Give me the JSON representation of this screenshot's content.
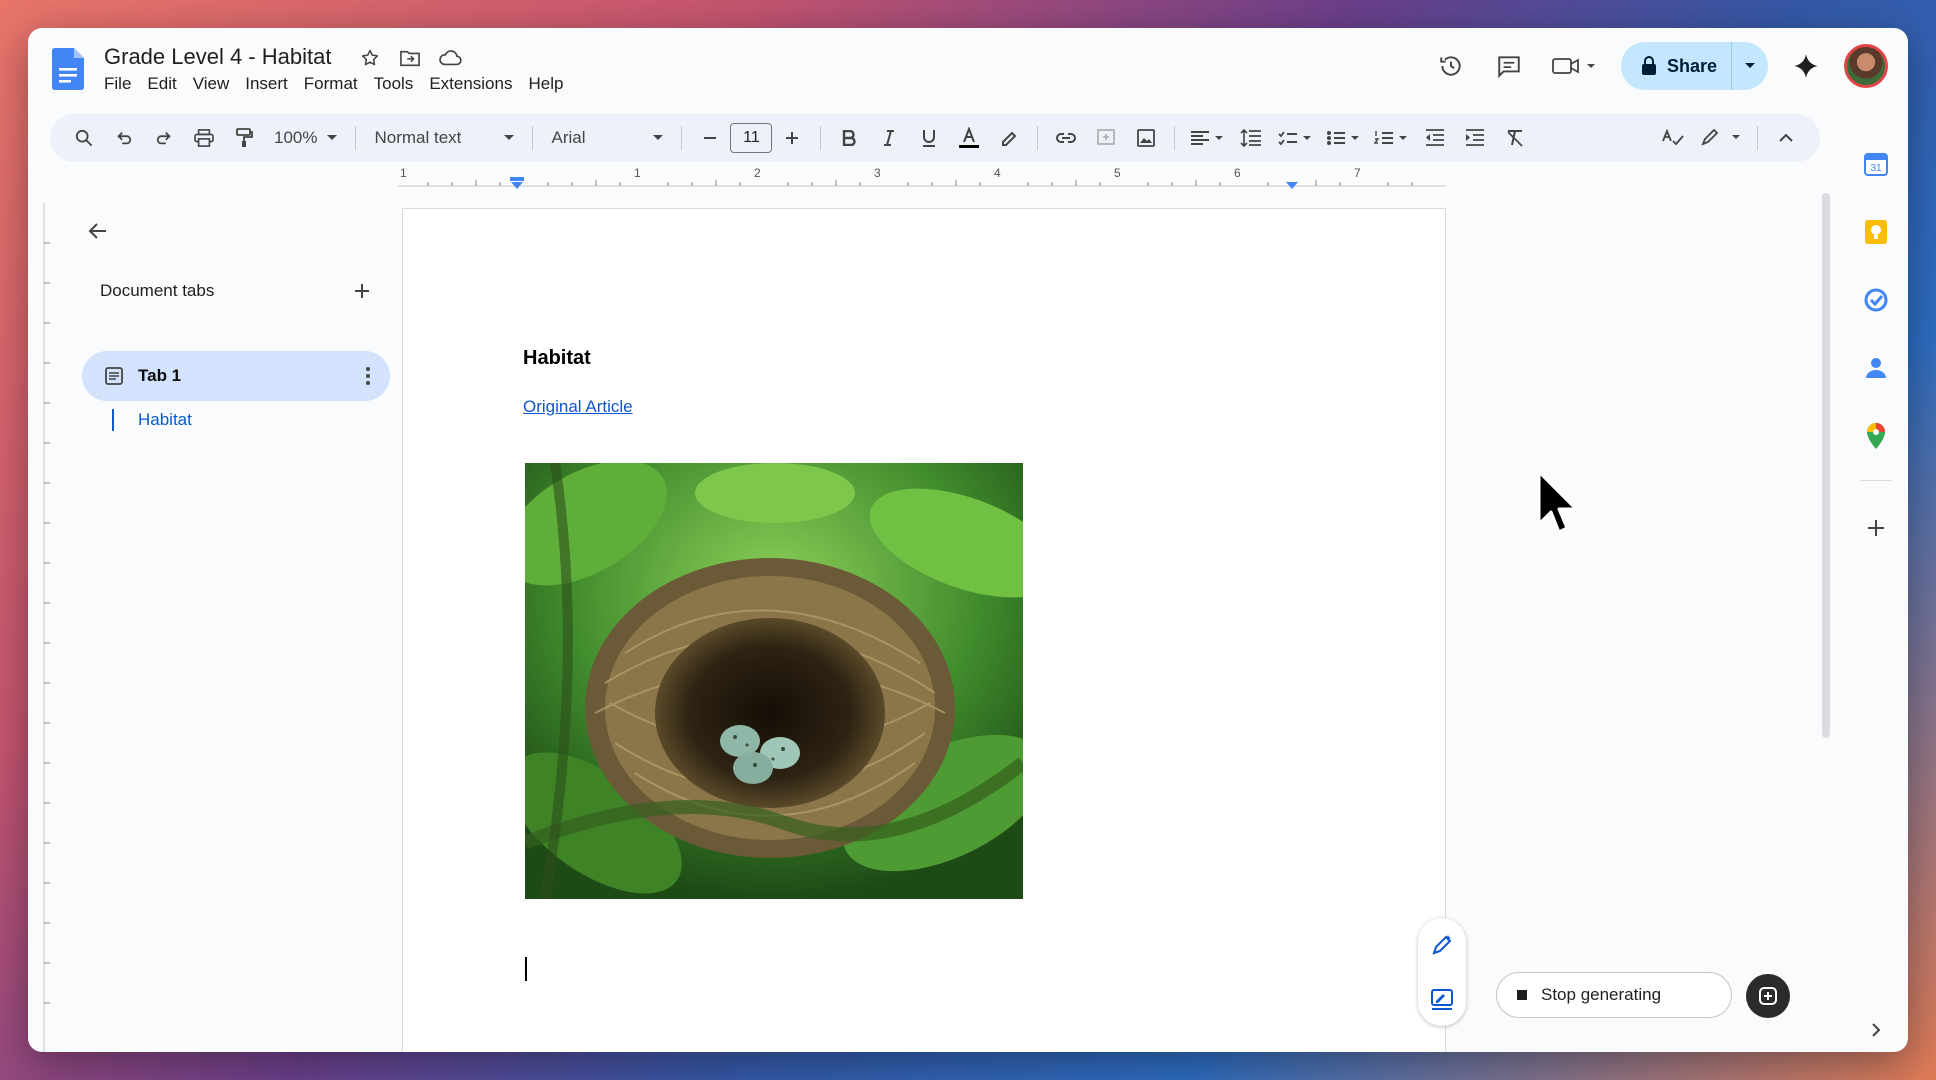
{
  "document": {
    "title": "Grade Level 4 - Habitat"
  },
  "menu": [
    "File",
    "Edit",
    "View",
    "Insert",
    "Format",
    "Tools",
    "Extensions",
    "Help"
  ],
  "share": {
    "label": "Share"
  },
  "toolbar": {
    "zoom": "100%",
    "style": "Normal text",
    "font": "Arial",
    "font_size": "11"
  },
  "ruler": {
    "labels": [
      "1",
      "1",
      "2",
      "3",
      "4",
      "5",
      "6",
      "7"
    ]
  },
  "sidebar": {
    "title": "Document tabs",
    "tabs": [
      {
        "label": "Tab 1",
        "headings": [
          "Habitat"
        ]
      }
    ]
  },
  "page": {
    "heading": "Habitat",
    "link_text": "Original Article",
    "image_icon": "bird-nest-with-eggs-photo"
  },
  "ai": {
    "stop_label": "Stop generating"
  },
  "colors": {
    "accent": "#0b57d0",
    "share_bg": "#c2e7ff",
    "toolbar_bg": "#edf2fa",
    "tab_selected_bg": "#d3e3fd",
    "link": "#1155cc"
  },
  "icons": {
    "title": [
      "star-icon",
      "move-folder-icon",
      "cloud-saved-icon"
    ],
    "top_right": [
      "version-history-icon",
      "comments-icon",
      "meet-icon",
      "gemini-icon"
    ],
    "side_panel": [
      "calendar-icon",
      "keep-icon",
      "tasks-icon",
      "contacts-icon",
      "maps-icon",
      "add-addon-icon"
    ]
  }
}
